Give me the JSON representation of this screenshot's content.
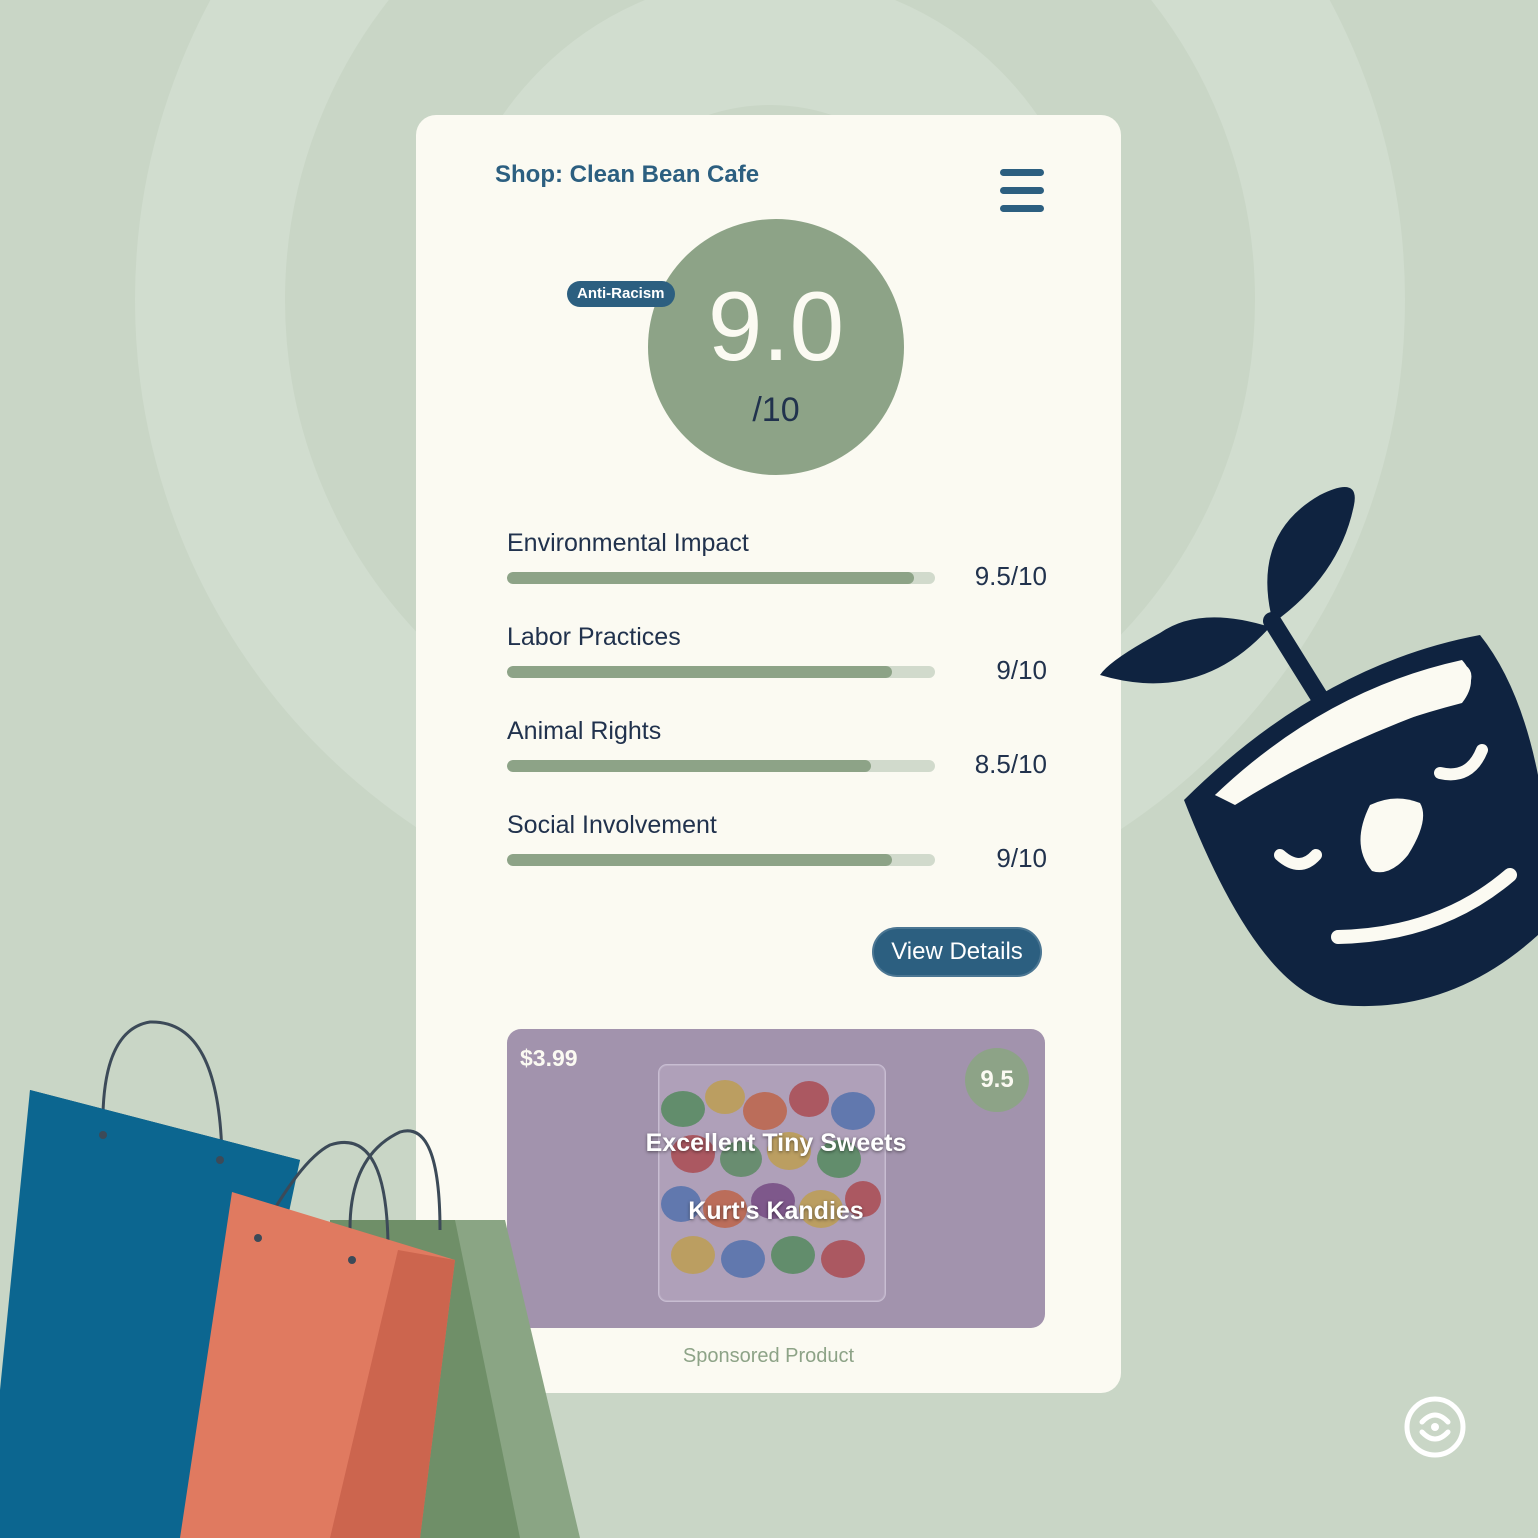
{
  "shop": {
    "title": "Shop: Clean Bean Cafe"
  },
  "score": {
    "value": "9.0",
    "out_of": "/10",
    "badge": "Anti-Racism"
  },
  "metrics": [
    {
      "label": "Environmental Impact",
      "value": "9.5/10",
      "fraction": 0.95
    },
    {
      "label": "Labor Practices",
      "value": "9/10",
      "fraction": 0.9
    },
    {
      "label": "Animal Rights",
      "value": "8.5/10",
      "fraction": 0.85
    },
    {
      "label": "Social Involvement",
      "value": "9/10",
      "fraction": 0.9
    }
  ],
  "actions": {
    "view_details": "View Details"
  },
  "product": {
    "price": "$3.99",
    "rating": "9.5",
    "name": "Excellent Tiny Sweets",
    "brand": "Kurt's Kandies",
    "sponsored_label": "Sponsored Product"
  },
  "icons": {
    "menu": "hamburger-menu-icon",
    "mascot": "smiling-plant-pot-icon",
    "bags": "shopping-bags-illustration",
    "logo": "circle-logo-icon"
  },
  "colors": {
    "background": "#c9d6c6",
    "card": "#fbfaf2",
    "accent_blue": "#2c5f80",
    "sage": "#8da387",
    "navy": "#0f2340",
    "product_bg": "#a293ad"
  }
}
